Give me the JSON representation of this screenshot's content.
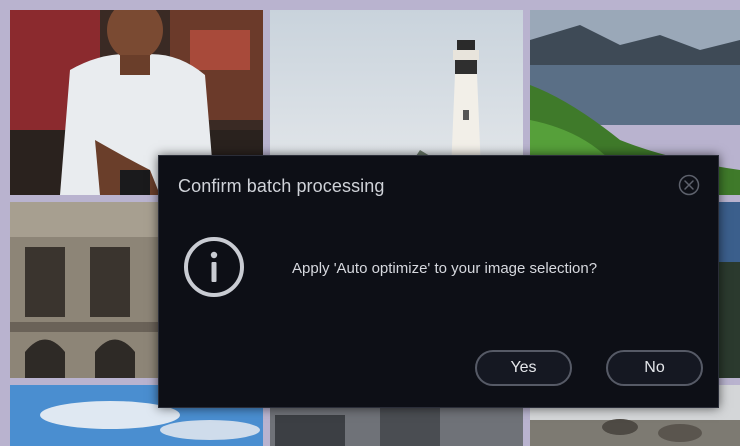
{
  "dialog": {
    "title": "Confirm batch processing",
    "message": "Apply 'Auto optimize' to your image selection?",
    "yes_label": "Yes",
    "no_label": "No",
    "icons": {
      "info": "info-icon",
      "close": "close-circle-icon"
    }
  },
  "background": {
    "thumbnails": [
      "man-in-shop-photo",
      "lighthouse-photo",
      "coastal-landscape-photo",
      "old-building-photo",
      "sky-beach-photo",
      "city-building-photo",
      "rocky-shore-photo"
    ]
  },
  "colors": {
    "dialog_bg": "#0d0f16",
    "button_border": "#565a66",
    "text": "#d6d8de"
  }
}
